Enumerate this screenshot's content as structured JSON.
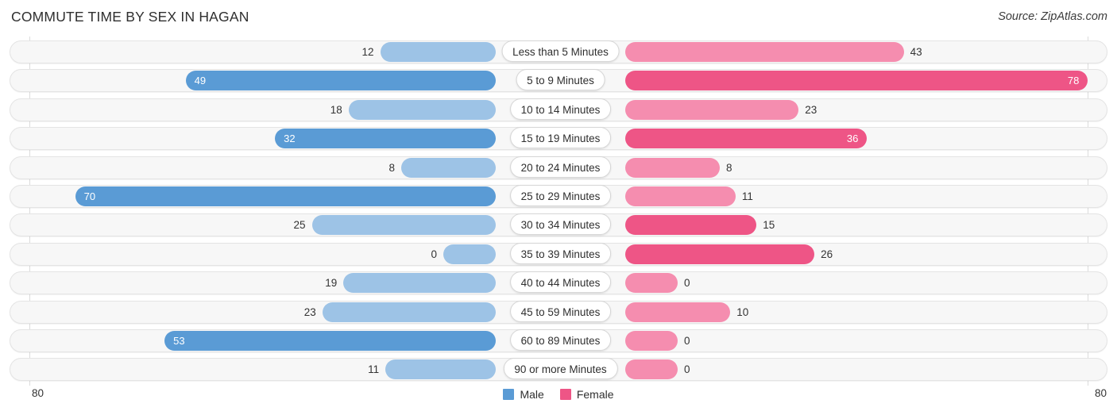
{
  "header": {
    "title": "COMMUTE TIME BY SEX IN HAGAN",
    "source": "Source: ZipAtlas.com"
  },
  "axis": {
    "left_tick": "80",
    "right_tick": "80",
    "max": 80
  },
  "legend": {
    "items": [
      {
        "label": "Male",
        "color": "#5a9bd5"
      },
      {
        "label": "Female",
        "color": "#ee5586"
      }
    ]
  },
  "colors": {
    "male_strong": "#5a9bd5",
    "male_light": "#9dc3e6",
    "female_strong": "#ee5586",
    "female_light": "#f58daf",
    "track": "#f7f7f7",
    "track_border": "#e4e4e4",
    "gridline": "#dcdcdc"
  },
  "chart_data": {
    "type": "bar",
    "title": "COMMUTE TIME BY SEX IN HAGAN",
    "subtitle": "Source: ZipAtlas.com",
    "orientation": "horizontal-diverging",
    "xlabel": "",
    "ylabel": "",
    "xlim": [
      80,
      80
    ],
    "grid": true,
    "legend_position": "bottom-center",
    "categories": [
      "Less than 5 Minutes",
      "5 to 9 Minutes",
      "10 to 14 Minutes",
      "15 to 19 Minutes",
      "20 to 24 Minutes",
      "25 to 29 Minutes",
      "30 to 34 Minutes",
      "35 to 39 Minutes",
      "40 to 44 Minutes",
      "45 to 59 Minutes",
      "60 to 89 Minutes",
      "90 or more Minutes"
    ],
    "series": [
      {
        "name": "Male",
        "values": [
          12,
          49,
          18,
          32,
          8,
          70,
          25,
          0,
          19,
          23,
          53,
          11
        ]
      },
      {
        "name": "Female",
        "values": [
          43,
          78,
          23,
          36,
          8,
          11,
          15,
          26,
          0,
          10,
          0,
          0
        ]
      }
    ]
  },
  "rows": [
    {
      "category": "Less than 5 Minutes",
      "male": "12",
      "female": "43",
      "male_highlight": false,
      "female_highlight": false
    },
    {
      "category": "5 to 9 Minutes",
      "male": "49",
      "female": "78",
      "male_highlight": true,
      "female_highlight": true
    },
    {
      "category": "10 to 14 Minutes",
      "male": "18",
      "female": "23",
      "male_highlight": false,
      "female_highlight": false
    },
    {
      "category": "15 to 19 Minutes",
      "male": "32",
      "female": "36",
      "male_highlight": true,
      "female_highlight": true
    },
    {
      "category": "20 to 24 Minutes",
      "male": "8",
      "female": "8",
      "male_highlight": false,
      "female_highlight": false
    },
    {
      "category": "25 to 29 Minutes",
      "male": "70",
      "female": "11",
      "male_highlight": true,
      "female_highlight": false
    },
    {
      "category": "30 to 34 Minutes",
      "male": "25",
      "female": "15",
      "male_highlight": false,
      "female_highlight": true
    },
    {
      "category": "35 to 39 Minutes",
      "male": "0",
      "female": "26",
      "male_highlight": false,
      "female_highlight": true
    },
    {
      "category": "40 to 44 Minutes",
      "male": "19",
      "female": "0",
      "male_highlight": false,
      "female_highlight": false
    },
    {
      "category": "45 to 59 Minutes",
      "male": "23",
      "female": "10",
      "male_highlight": false,
      "female_highlight": false
    },
    {
      "category": "60 to 89 Minutes",
      "male": "53",
      "female": "0",
      "male_highlight": true,
      "female_highlight": false
    },
    {
      "category": "90 or more Minutes",
      "male": "11",
      "female": "0",
      "male_highlight": false,
      "female_highlight": false
    }
  ]
}
